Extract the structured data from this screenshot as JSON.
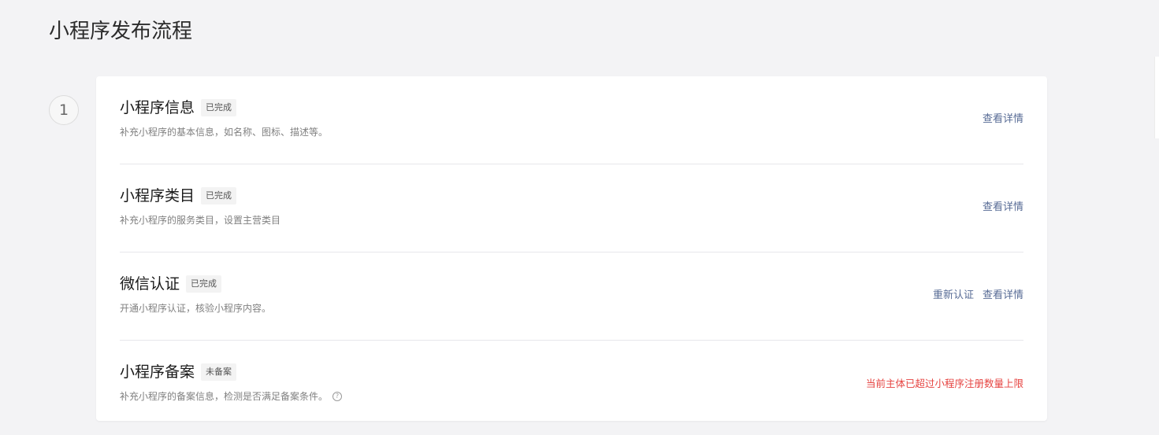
{
  "page": {
    "title": "小程序发布流程"
  },
  "step": {
    "number": "1"
  },
  "rows": [
    {
      "title": "小程序信息",
      "badge": "已完成",
      "desc": "补充小程序的基本信息，如名称、图标、描述等。",
      "actions": [
        "查看详情"
      ]
    },
    {
      "title": "小程序类目",
      "badge": "已完成",
      "desc": "补充小程序的服务类目，设置主营类目",
      "actions": [
        "查看详情"
      ]
    },
    {
      "title": "微信认证",
      "badge": "已完成",
      "desc": "开通小程序认证，核验小程序内容。",
      "actions": [
        "重新认证",
        "查看详情"
      ]
    },
    {
      "title": "小程序备案",
      "badge": "未备案",
      "desc": "补充小程序的备案信息，检测是否满足备案条件。",
      "help_icon": "help-circle-icon",
      "warning": "当前主体已超过小程序注册数量上限"
    }
  ],
  "colors": {
    "link": "#576b95",
    "warning": "#e64340",
    "background": "#f3f3f5"
  }
}
